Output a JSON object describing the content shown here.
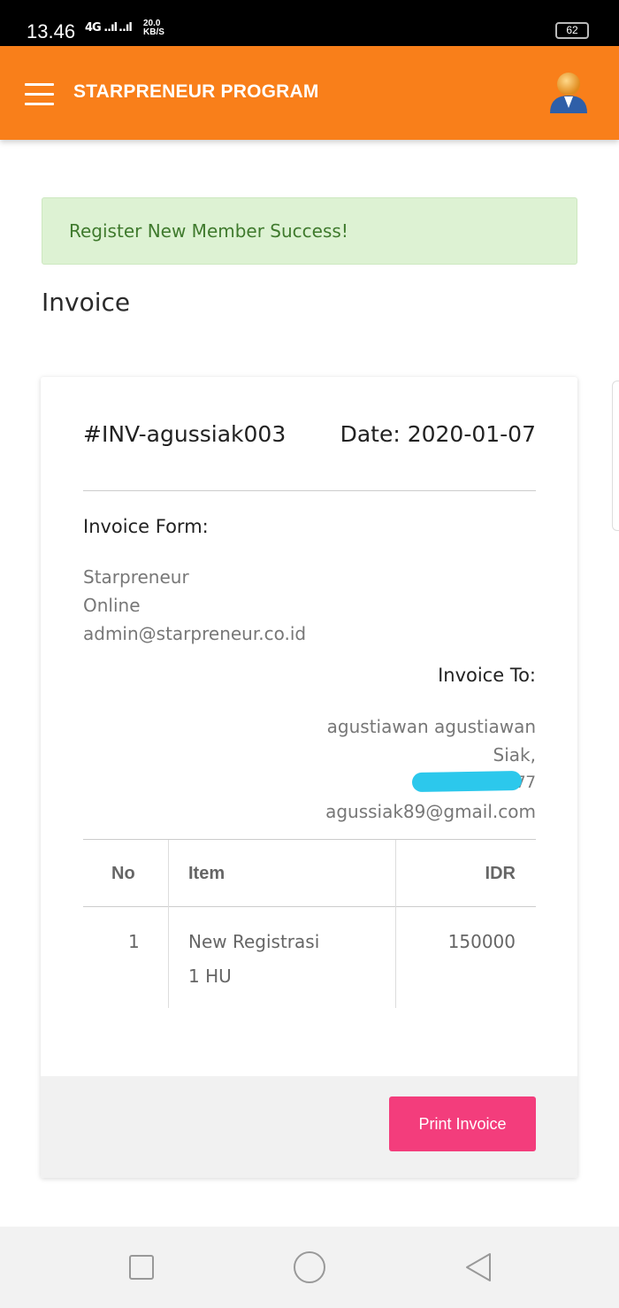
{
  "status_bar": {
    "time": "13.46",
    "signal_1": "4G ..ıl",
    "signal_2": "..ıl",
    "speed_value": "20.0",
    "speed_unit": "KB/S",
    "battery": "62"
  },
  "header": {
    "menu_icon": "hamburger-icon",
    "title": "STARPRENEUR PROGRAM",
    "avatar_icon": "user-avatar-icon",
    "color": "#f97f1a"
  },
  "alert": {
    "message": "Register New Member Success!",
    "color": "#ddf2d3"
  },
  "page": {
    "title": "Invoice"
  },
  "invoice": {
    "number": "#INV-agussiak003",
    "date": "Date: 2020-01-07",
    "from_title": "Invoice Form:",
    "from_lines": [
      "Starpreneur",
      "Online",
      "admin@starpreneur.co.id"
    ],
    "to_title": "Invoice To:",
    "to_lines": [
      "agustiawan agustiawan",
      "Siak,",
      "08          77",
      "agussiak89@gmail.com"
    ],
    "table": {
      "headers": [
        "No",
        "Item",
        "IDR"
      ],
      "rows": [
        {
          "no": "1",
          "item_line1": "New Registrasi",
          "item_line2": "1 HU",
          "idr": "150000"
        }
      ]
    },
    "print_label": "Print Invoice",
    "print_color": "#f33d7c"
  },
  "nav": {
    "recent_icon": "recent-apps-icon",
    "home_icon": "home-icon",
    "back_icon": "back-icon"
  }
}
